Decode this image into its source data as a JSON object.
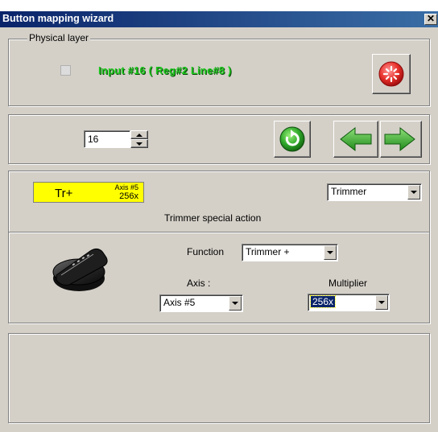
{
  "window": {
    "title": "Button mapping wizard",
    "close_glyph": "✕"
  },
  "physical_layer": {
    "legend": "Physical layer",
    "input_text": "Input #16  ( Reg#2   Line#8 )"
  },
  "controls": {
    "number_value": "16"
  },
  "mapping": {
    "badge_label": "Tr+",
    "badge_axis": "Axis #5",
    "badge_multiplier": "256x",
    "mode_selected": "Trimmer",
    "description": "Trimmer special action",
    "function_label": "Function",
    "function_selected": "Trimmer +",
    "axis_label": "Axis :",
    "axis_selected": "Axis #5",
    "multiplier_label": "Multiplier",
    "multiplier_selected": "256x"
  },
  "colors": {
    "badge_bg": "#ffff00",
    "green_text": "#1ec81e",
    "title_bar": "#0a246a",
    "selection": "#0a246a"
  },
  "icons": {
    "stop": "stop-icon",
    "refresh": "refresh-icon",
    "back": "arrow-left-icon",
    "next": "arrow-right-icon",
    "trim_knob": "trim-knob-icon"
  }
}
